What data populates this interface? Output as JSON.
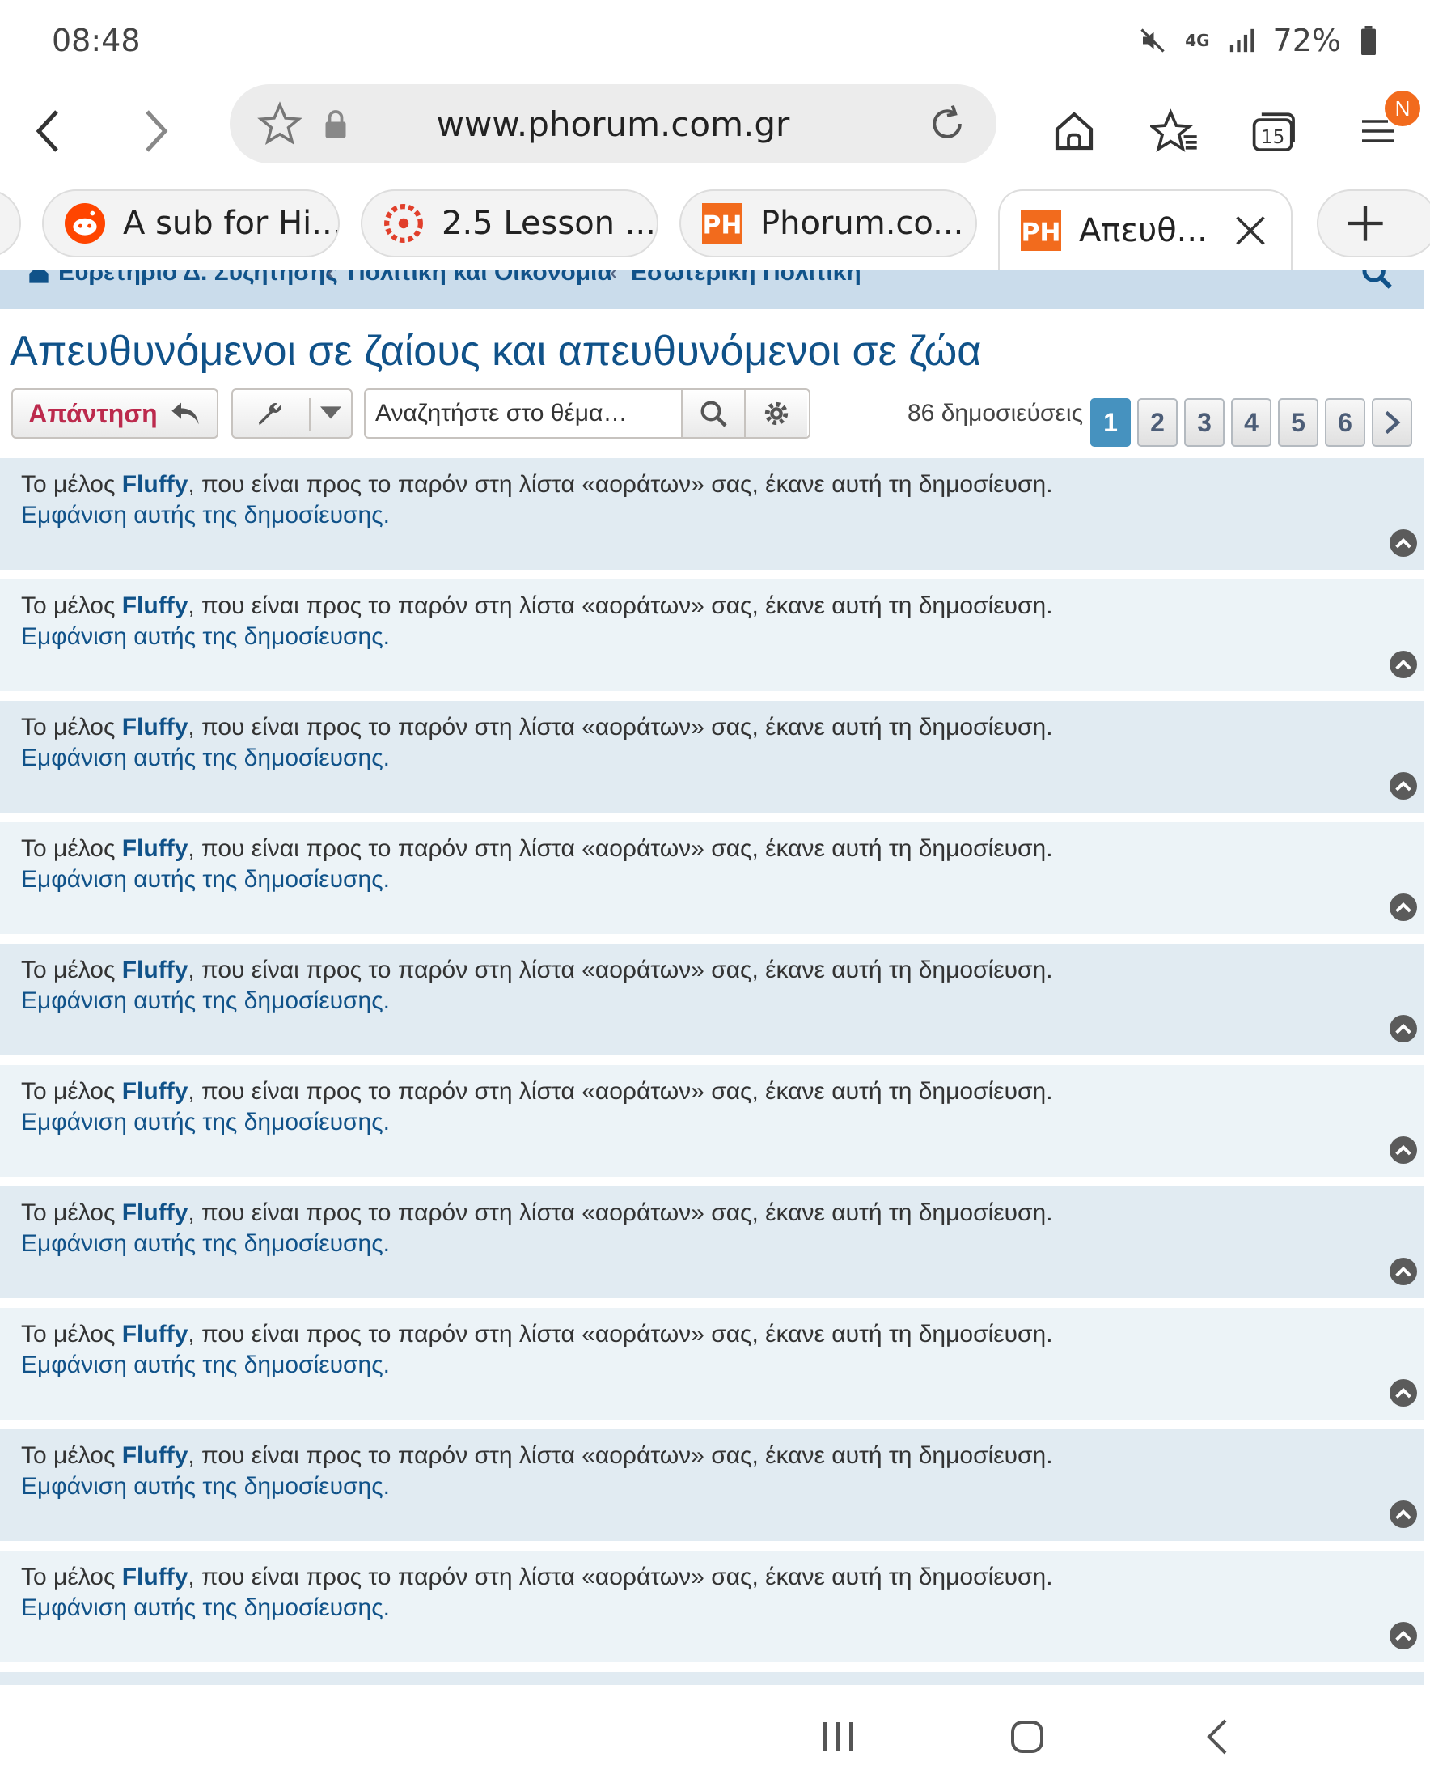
{
  "status": {
    "time": "08:48",
    "network": "4G",
    "battery": "72%"
  },
  "browser": {
    "url": "www.phorum.com.gr",
    "notification_badge": "N",
    "tab_count": "15",
    "tabs": [
      {
        "label": "A sub for Hi..."
      },
      {
        "label": "2.5 Lesson ..."
      },
      {
        "label": "Phorum.co..."
      },
      {
        "label": "Απευθ..."
      }
    ]
  },
  "breadcrumbs": [
    "Ευρετήριο Δ. Συζητήσης",
    "Πολιτική και Οικονομία",
    "Εσωτερική Πολιτική"
  ],
  "topic": {
    "title": "Απευθυνόμενοι σε ζαίους και απευθυνόμενοι σε ζώα",
    "reply_label": "Απάντηση",
    "search_placeholder": "Αναζητήστε στο θέμα…",
    "post_count": "86 δημοσιεύσεις",
    "pages": [
      "1",
      "2",
      "3",
      "4",
      "5",
      "6"
    ],
    "current_page": "1"
  },
  "ignored_posts": [
    {
      "before": "Το μέλος ",
      "user": "Fluffy",
      "after": ", που είναι προς το παρόν στη λίστα «αοράτων» σας, έκανε αυτή τη δημοσίευση.",
      "link": "Εμφάνιση αυτής της δημοσίευσης."
    },
    {
      "before": "Το μέλος ",
      "user": "Fluffy",
      "after": ", που είναι προς το παρόν στη λίστα «αοράτων» σας, έκανε αυτή τη δημοσίευση.",
      "link": "Εμφάνιση αυτής της δημοσίευσης."
    },
    {
      "before": "Το μέλος ",
      "user": "Fluffy",
      "after": ", που είναι προς το παρόν στη λίστα «αοράτων» σας, έκανε αυτή τη δημοσίευση.",
      "link": "Εμφάνιση αυτής της δημοσίευσης."
    },
    {
      "before": "Το μέλος ",
      "user": "Fluffy",
      "after": ", που είναι προς το παρόν στη λίστα «αοράτων» σας, έκανε αυτή τη δημοσίευση.",
      "link": "Εμφάνιση αυτής της δημοσίευσης."
    },
    {
      "before": "Το μέλος ",
      "user": "Fluffy",
      "after": ", που είναι προς το παρόν στη λίστα «αοράτων» σας, έκανε αυτή τη δημοσίευση.",
      "link": "Εμφάνιση αυτής της δημοσίευσης."
    },
    {
      "before": "Το μέλος ",
      "user": "Fluffy",
      "after": ", που είναι προς το παρόν στη λίστα «αοράτων» σας, έκανε αυτή τη δημοσίευση.",
      "link": "Εμφάνιση αυτής της δημοσίευσης."
    },
    {
      "before": "Το μέλος ",
      "user": "Fluffy",
      "after": ", που είναι προς το παρόν στη λίστα «αοράτων» σας, έκανε αυτή τη δημοσίευση.",
      "link": "Εμφάνιση αυτής της δημοσίευσης."
    },
    {
      "before": "Το μέλος ",
      "user": "Fluffy",
      "after": ", που είναι προς το παρόν στη λίστα «αοράτων» σας, έκανε αυτή τη δημοσίευση.",
      "link": "Εμφάνιση αυτής της δημοσίευσης."
    },
    {
      "before": "Το μέλος ",
      "user": "Fluffy",
      "after": ", που είναι προς το παρόν στη λίστα «αοράτων» σας, έκανε αυτή τη δημοσίευση.",
      "link": "Εμφάνιση αυτής της δημοσίευσης."
    },
    {
      "before": "Το μέλος ",
      "user": "Fluffy",
      "after": ", που είναι προς το παρόν στη λίστα «αοράτων» σας, έκανε αυτή τη δημοσίευση.",
      "link": "Εμφάνιση αυτής της δημοσίευσης."
    }
  ],
  "colors": {
    "link": "#105289",
    "reply": "#bc2a4d",
    "post_row_a": "#e1ebf2",
    "post_row_b": "#ecf3f7",
    "current_page": "#4692bf"
  }
}
